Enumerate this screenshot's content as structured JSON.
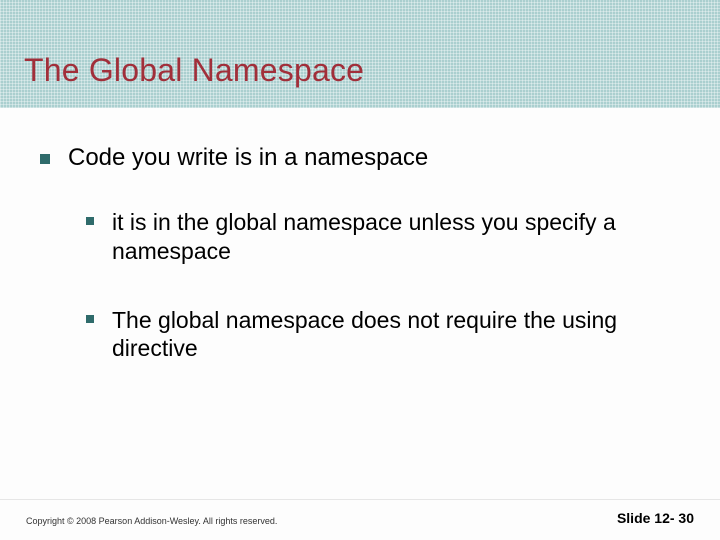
{
  "title": "The Global Namespace",
  "bullets": {
    "lvl1": "Code you write is in a namespace",
    "lvl2": [
      "it is in the global namespace unless you specify a namespace",
      "The global namespace does not require the using directive"
    ]
  },
  "footer": {
    "copyright": "Copyright © 2008 Pearson Addison-Wesley. All rights reserved.",
    "slide_label": "Slide 12- 30"
  }
}
